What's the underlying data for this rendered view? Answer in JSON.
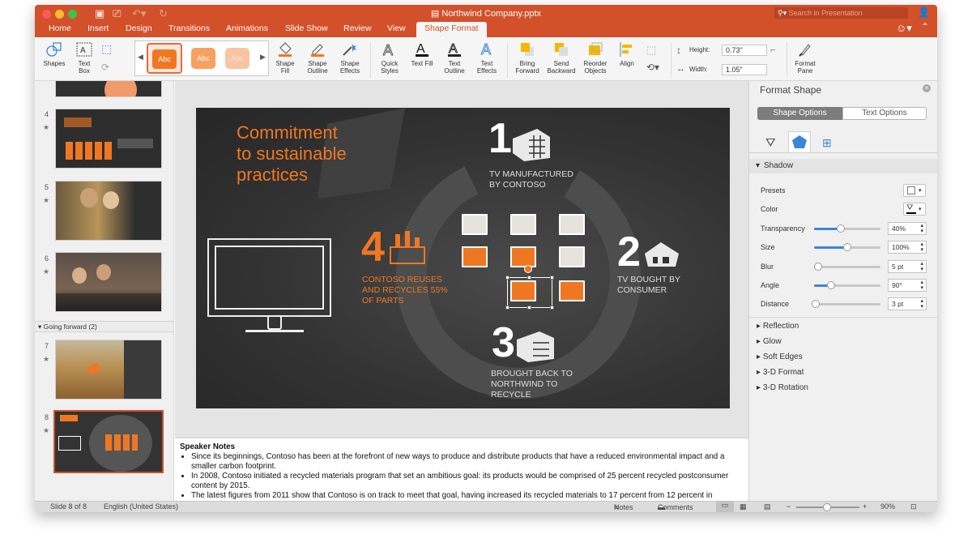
{
  "window": {
    "document_title": "Northwind Company.pptx",
    "search_placeholder": "Search in Presentation"
  },
  "tabs": [
    "Home",
    "Insert",
    "Design",
    "Transitions",
    "Animations",
    "Slide Show",
    "Review",
    "View",
    "Shape Format"
  ],
  "ribbon": {
    "shapes": "Shapes",
    "text_box_1": "Text",
    "text_box_2": "Box",
    "style_label": "Abc",
    "shape_fill_1": "Shape",
    "shape_fill_2": "Fill",
    "shape_outline_1": "Shape",
    "shape_outline_2": "Outline",
    "shape_effects_1": "Shape",
    "shape_effects_2": "Effects",
    "quick_styles_1": "Quick",
    "quick_styles_2": "Styles",
    "text_fill": "Text Fill",
    "text_outline_1": "Text",
    "text_outline_2": "Outline",
    "text_effects_1": "Text",
    "text_effects_2": "Effects",
    "bring_forward_1": "Bring",
    "bring_forward_2": "Forward",
    "send_backward_1": "Send",
    "send_backward_2": "Backward",
    "reorder_1": "Reorder",
    "reorder_2": "Objects",
    "align": "Align",
    "height_label": "Height:",
    "height_value": "0.73\"",
    "width_label": "Width:",
    "width_value": "1.05\"",
    "format_pane_1": "Format",
    "format_pane_2": "Pane"
  },
  "thumbnails": {
    "n4": "4",
    "n5": "5",
    "n6": "6",
    "n7": "7",
    "n8": "8",
    "section": "Going forward (2)"
  },
  "slide": {
    "title_l1": "Commitment",
    "title_l2": "to sustainable",
    "title_l3": "practices",
    "s1_num": "1",
    "s1_l1": "TV MANUFACTURED",
    "s1_l2": "BY CONTOSO",
    "s2_num": "2",
    "s2_l1": "TV BOUGHT BY",
    "s2_l2": "CONSUMER",
    "s3_num": "3",
    "s3_l1": "BROUGHT BACK TO",
    "s3_l2": "NORTHWIND TO",
    "s3_l3": "RECYCLE",
    "s4_num": "4",
    "s4_l1": "CONTOSO REUSES",
    "s4_l2": "AND RECYCLES 55%",
    "s4_l3": "OF PARTS"
  },
  "notes": {
    "heading": "Speaker Notes",
    "b1": "Since its beginnings, Contoso has been at the forefront of new ways to produce and distribute products that have a reduced environmental impact and a smaller carbon footprint.",
    "b2": "In 2008, Contoso initiated a recycled materials program that set an ambitious goal: its products would be comprised of 25 percent recycled postconsumer content by 2015.",
    "b3": "The latest figures from 2011 show that Contoso is on track to meet that goal, having increased its recycled materials to 17 percent from 12 percent in"
  },
  "format_pane": {
    "title": "Format Shape",
    "tab_shape": "Shape Options",
    "tab_text": "Text Options",
    "shadow": "Shadow",
    "presets": "Presets",
    "color": "Color",
    "transparency": "Transparency",
    "transparency_val": "40%",
    "transparency_frac": 0.4,
    "size": "Size",
    "size_val": "100%",
    "size_frac": 0.5,
    "blur": "Blur",
    "blur_val": "5 pt",
    "blur_frac": 0.06,
    "angle": "Angle",
    "angle_val": "90°",
    "angle_frac": 0.25,
    "distance": "Distance",
    "distance_val": "3 pt",
    "distance_frac": 0.03,
    "reflection": "Reflection",
    "glow": "Glow",
    "soft_edges": "Soft Edges",
    "format_3d": "3-D Format",
    "rotation_3d": "3-D Rotation"
  },
  "status": {
    "slide": "Slide 8 of 8",
    "language": "English (United States)",
    "notes": "Notes",
    "comments": "Comments",
    "zoom": "90%"
  },
  "colors": {
    "accent": "#d2502a",
    "orange": "#f07722",
    "selection_blue": "#3b86d9"
  }
}
